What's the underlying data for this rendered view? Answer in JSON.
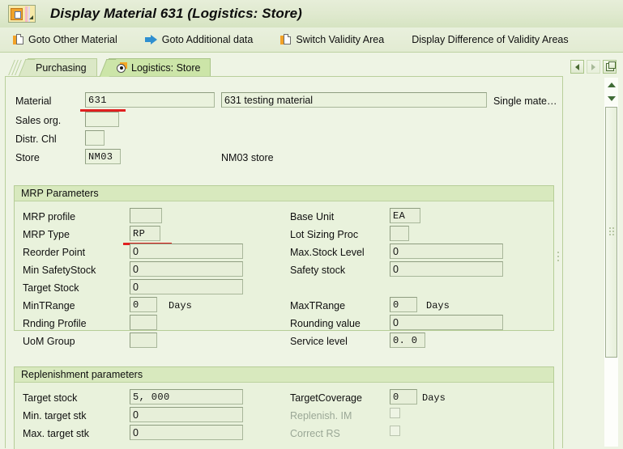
{
  "window": {
    "title": "Display Material 631 (Logistics: Store)",
    "system_icon": "sap-document-icon"
  },
  "toolbar": {
    "buttons": [
      {
        "label": "Goto Other Material",
        "icon": "new-document-icon"
      },
      {
        "label": "Goto Additional data",
        "icon": "blue-arrow-right-icon"
      },
      {
        "label": "Switch Validity Area",
        "icon": "new-document-icon"
      },
      {
        "label": "Display Difference of Validity Areas",
        "icon": "none"
      }
    ]
  },
  "tabs": [
    {
      "label": "Purchasing",
      "active": false
    },
    {
      "label": "Logistics: Store",
      "active": true,
      "icon": "radio-selected-icon"
    }
  ],
  "nav_buttons": [
    {
      "name": "previous-tab-button",
      "icon": "triangle-left-icon",
      "enabled": true
    },
    {
      "name": "next-tab-button",
      "icon": "triangle-right-icon",
      "enabled": false
    },
    {
      "name": "tab-list-button",
      "icon": "panel-icon",
      "enabled": true
    }
  ],
  "header": {
    "material_label": "Material",
    "material_value": "631",
    "material_description": "631 testing material",
    "single_material_text": "Single mate…",
    "sales_org_label": "Sales org.",
    "sales_org_value": "",
    "distr_chl_label": "Distr. Chl",
    "distr_chl_value": "",
    "store_label": "Store",
    "store_value": "NM03",
    "store_description": "NM03 store"
  },
  "mrp": {
    "title": "MRP Parameters",
    "left": [
      {
        "label": "MRP profile",
        "value": "",
        "width": "small",
        "suffix": ""
      },
      {
        "label": "MRP Type",
        "value": "RP",
        "width": "tiny",
        "suffix": "",
        "mono": true
      },
      {
        "label": "Reorder Point",
        "value": "0",
        "width": "wide",
        "suffix": ""
      },
      {
        "label": "Min SafetyStock",
        "value": "0",
        "width": "wide",
        "suffix": ""
      },
      {
        "label": "Target Stock",
        "value": "0",
        "width": "wide",
        "suffix": ""
      },
      {
        "label": "MinTRange",
        "value": "0",
        "width": "tiny",
        "suffix": "Days",
        "mono": true
      },
      {
        "label": "Rnding Profile",
        "value": "",
        "width": "small",
        "suffix": ""
      },
      {
        "label": "UoM Group",
        "value": "",
        "width": "small",
        "suffix": ""
      }
    ],
    "right": [
      {
        "label": "Base Unit",
        "value": "EA",
        "width": "tiny",
        "suffix": "",
        "mono": true
      },
      {
        "label": "Lot Sizing Proc",
        "value": "",
        "width": "small",
        "suffix": ""
      },
      {
        "label": "Max.Stock Level",
        "value": "0",
        "width": "wide",
        "suffix": ""
      },
      {
        "label": "Safety stock",
        "value": "0",
        "width": "wide",
        "suffix": ""
      },
      {
        "label": "MaxTRange",
        "value": "0",
        "width": "tiny",
        "suffix": "Days",
        "mono": true
      },
      {
        "label": "Rounding value",
        "value": "0",
        "width": "wide",
        "suffix": ""
      },
      {
        "label": "Service level",
        "value": "0. 0",
        "width": "tiny2",
        "suffix": "",
        "mono": true
      }
    ]
  },
  "replenishment": {
    "title": "Replenishment parameters",
    "left": [
      {
        "label": "Target stock",
        "value": "5, 000",
        "width": "wide",
        "mono": true
      },
      {
        "label": "Min. target stk",
        "value": "0",
        "width": "wide"
      },
      {
        "label": "Max. target stk",
        "value": "0",
        "width": "wide"
      }
    ],
    "right": [
      {
        "label": "TargetCoverage",
        "value": "0",
        "width": "tiny",
        "suffix": "Days",
        "mono": true,
        "type": "field"
      },
      {
        "label": "Replenish. IM",
        "checked": false,
        "disabled": true,
        "type": "checkbox"
      },
      {
        "label": "Correct RS",
        "checked": false,
        "disabled": true,
        "type": "checkbox"
      }
    ]
  },
  "annotations": [
    {
      "name": "material-underline",
      "color": "#e02020"
    },
    {
      "name": "mrp-type-underline",
      "color": "#e02020"
    }
  ],
  "scrollbar": {
    "up_icon": "triangle-up-icon",
    "down_icon": "triangle-down-icon"
  }
}
